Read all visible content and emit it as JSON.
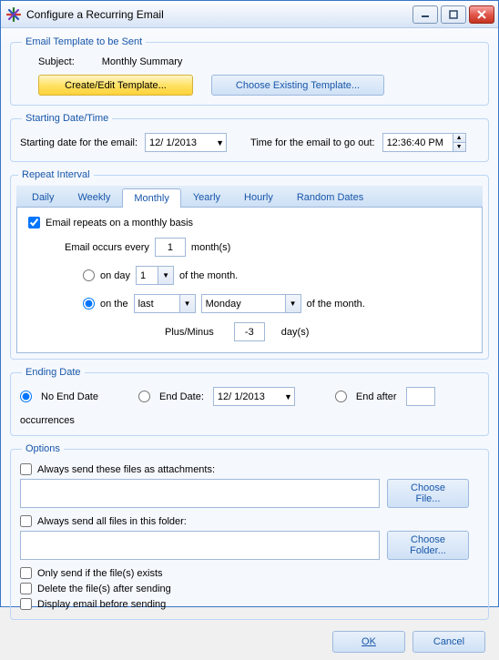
{
  "window": {
    "title": "Configure a Recurring Email"
  },
  "template": {
    "legend": "Email Template to be Sent",
    "subject_label": "Subject:",
    "subject_value": "Monthly Summary",
    "create_btn": "Create/Edit Template...",
    "choose_btn": "Choose Existing Template..."
  },
  "starting": {
    "legend": "Starting Date/Time",
    "date_label": "Starting date for the email:",
    "date_value": "12/ 1/2013",
    "time_label": "Time for the email to go out:",
    "time_value": "12:36:40 PM"
  },
  "repeat": {
    "legend": "Repeat Interval",
    "tabs": [
      "Daily",
      "Weekly",
      "Monthly",
      "Yearly",
      "Hourly",
      "Random Dates"
    ],
    "active_tab_index": 2,
    "chk_label": "Email repeats on a monthly basis",
    "occurs_every_label": "Email occurs every",
    "occurs_every_value": "1",
    "months_label": "month(s)",
    "on_day_label": "on day",
    "on_day_value": "1",
    "of_month_label": "of the month.",
    "on_the_label": "on the",
    "ordinal_value": "last",
    "weekday_value": "Monday",
    "plus_minus_label": "Plus/Minus",
    "plus_minus_value": "-3",
    "days_label": "day(s)"
  },
  "ending": {
    "legend": "Ending Date",
    "no_end_label": "No End Date",
    "end_date_label": "End Date:",
    "end_date_value": "12/ 1/2013",
    "end_after_label": "End after",
    "end_after_value": "",
    "occurrences_label": "occurrences"
  },
  "options": {
    "legend": "Options",
    "attach_label": "Always send these files as attachments:",
    "attach_value": "",
    "choose_file_btn": "Choose File...",
    "folder_label": "Always send all files in this folder:",
    "folder_value": "",
    "choose_folder_btn": "Choose Folder...",
    "only_if_exists_label": "Only send if the file(s) exists",
    "delete_after_label": "Delete the file(s) after sending",
    "display_before_label": "Display email before sending"
  },
  "footer": {
    "ok": "OK",
    "cancel": "Cancel"
  }
}
